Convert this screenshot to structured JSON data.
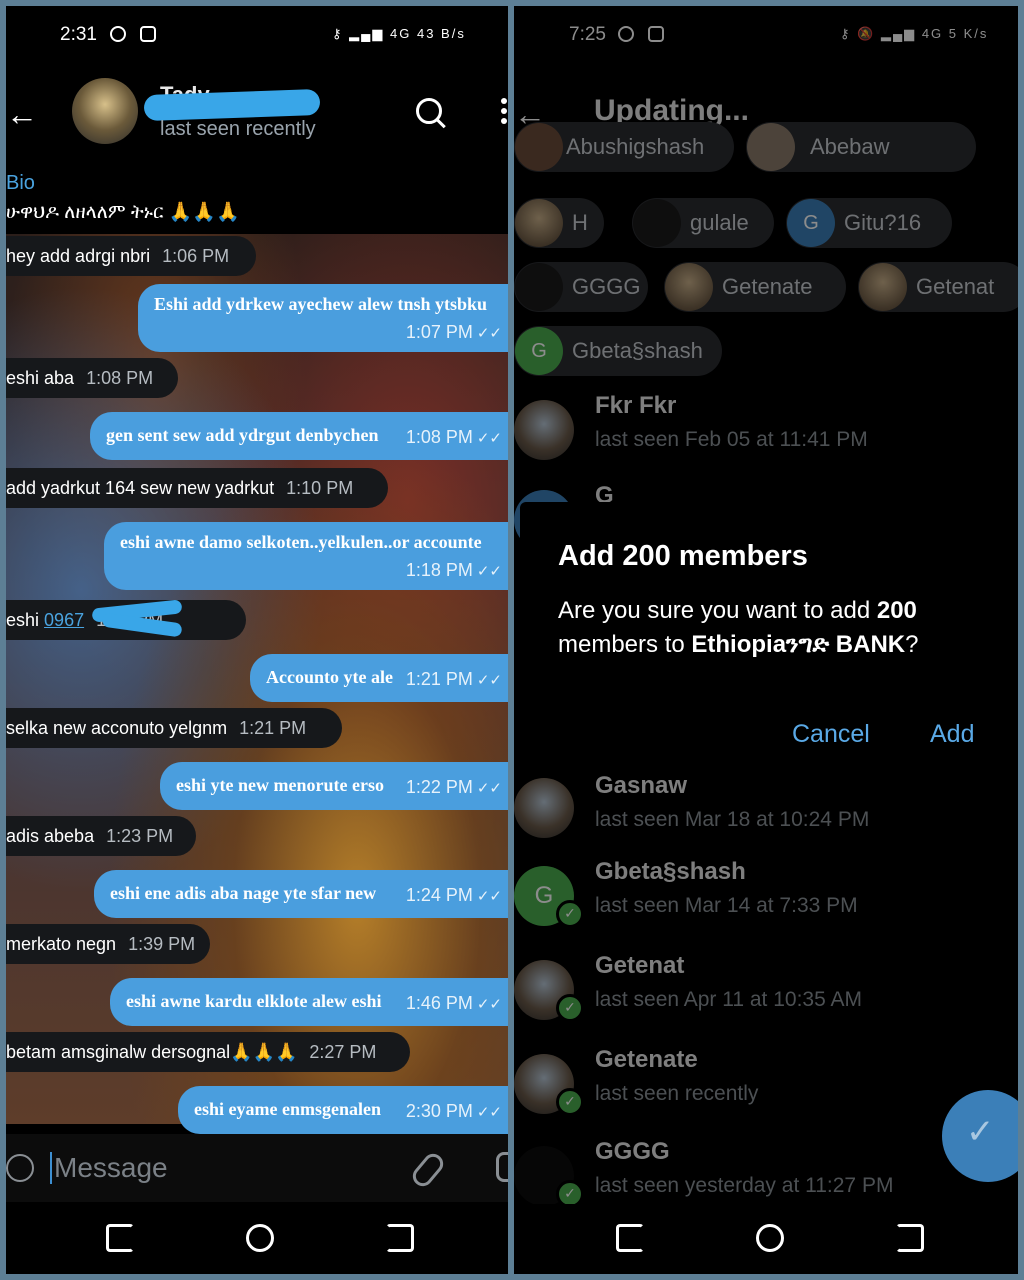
{
  "left": {
    "status_time": "2:31",
    "status_net": "4G",
    "status_speed": "43 B/s",
    "chat_name": "Tady",
    "chat_status": "last seen recently",
    "bio_label": "Bio",
    "bio_text": "ሁዋህዶ ለዘላለም ትኑር 🙏🙏🙏",
    "messages": [
      {
        "dir": "in",
        "text": "hey add adrgi nbri",
        "time": "1:06 PM"
      },
      {
        "dir": "out",
        "text": "Eshi add ydrkew ayechew alew tnsh ytsbku",
        "time": "1:07 PM"
      },
      {
        "dir": "in",
        "text": "eshi aba",
        "time": "1:08 PM"
      },
      {
        "dir": "out",
        "text": "gen sent sew add ydrgut denbychen",
        "time": "1:08 PM"
      },
      {
        "dir": "in",
        "text": "add yadrkut 164 sew new yadrkut",
        "time": "1:10 PM"
      },
      {
        "dir": "out",
        "text": "eshi awne damo selkoten..yelkulen..or accounte",
        "time": "1:18 PM"
      },
      {
        "dir": "in",
        "text": "eshi",
        "link": "0967",
        "time": "1:20 PM"
      },
      {
        "dir": "out",
        "text": "Accounto yte ale",
        "time": "1:21 PM"
      },
      {
        "dir": "in",
        "text": "selka new acconuto yelgnm",
        "time": "1:21 PM"
      },
      {
        "dir": "out",
        "text": "eshi yte new menorute erso",
        "time": "1:22 PM"
      },
      {
        "dir": "in",
        "text": "adis abeba",
        "time": "1:23 PM"
      },
      {
        "dir": "out",
        "text": "eshi ene adis aba nage yte sfar new",
        "time": "1:24 PM"
      },
      {
        "dir": "in",
        "text": "merkato negn",
        "time": "1:39 PM"
      },
      {
        "dir": "out",
        "text": "eshi awne kardu elklote alew eshi",
        "time": "1:46 PM"
      },
      {
        "dir": "in",
        "text": "betam amsginalw dersognal🙏🙏🙏",
        "time": "2:27 PM"
      },
      {
        "dir": "out",
        "text": "eshi eyame enmsgenalen",
        "time": "2:30 PM"
      }
    ],
    "composer_placeholder": "Message"
  },
  "right": {
    "status_time": "7:25",
    "status_net": "4G",
    "status_speed": "5 K/s",
    "title": "Updating...",
    "chips_top": [
      "Abushigshash",
      "Abebaw"
    ],
    "chips": [
      {
        "label": "H",
        "avatar": "photo"
      },
      {
        "label": "gulale",
        "avatar": "dark"
      },
      {
        "label": "Gitu?16",
        "avatar": "letter",
        "letter": "G",
        "color": "#3b7fb8"
      },
      {
        "label": "GGGG",
        "avatar": "dark"
      },
      {
        "label": "Getenate",
        "avatar": "photo"
      },
      {
        "label": "Getenat",
        "avatar": "photo"
      },
      {
        "label": "Gbeta§shash",
        "avatar": "letter",
        "letter": "G",
        "color": "#4cae4f"
      }
    ],
    "contacts": [
      {
        "name": "Fkr Fkr",
        "status": "last seen Feb 05 at 11:41 PM",
        "avatar": "photo",
        "checked": false
      },
      {
        "name": "G",
        "status": "",
        "avatar": "letter",
        "letter": "",
        "color": "#3b7fb8",
        "checked": false
      },
      {
        "name": "Gasnaw",
        "status": "last seen Mar 18 at 10:24 PM",
        "avatar": "photo",
        "checked": false
      },
      {
        "name": "Gbeta§shash",
        "status": "last seen Mar 14 at 7:33 PM",
        "avatar": "letter",
        "letter": "G",
        "color": "#4cae4f",
        "checked": true
      },
      {
        "name": "Getenat",
        "status": "last seen Apr 11 at 10:35 AM",
        "avatar": "photo",
        "checked": true
      },
      {
        "name": "Getenate",
        "status": "last seen recently",
        "avatar": "photo",
        "checked": true
      },
      {
        "name": "GGGG",
        "status": "last seen yesterday at 11:27 PM",
        "avatar": "dark",
        "checked": true
      }
    ],
    "dialog": {
      "title": "Add 200 members",
      "text_prefix": "Are you sure you want to add ",
      "count": "200",
      "text_mid": " members to ",
      "group": "Ethiopiaንግድ BANK",
      "text_suffix": "?",
      "cancel": "Cancel",
      "add": "Add"
    }
  }
}
